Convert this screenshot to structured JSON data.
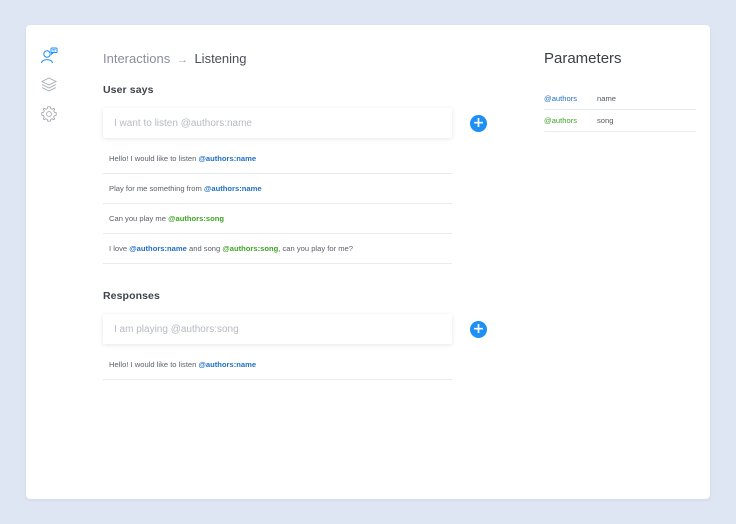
{
  "sidebar": {
    "icons": [
      {
        "name": "user-chat-icon",
        "active": true
      },
      {
        "name": "layers-icon",
        "active": false
      },
      {
        "name": "gear-icon",
        "active": false
      }
    ]
  },
  "breadcrumb": {
    "parent": "Interactions",
    "separator": "→",
    "current": "Listening"
  },
  "user_says": {
    "title": "User says",
    "placeholder": "I want to listen @authors:name",
    "add_label": "+",
    "items": [
      [
        {
          "text": "Hello! I would like to listen "
        },
        {
          "text": "@authors:name",
          "entity": "blue"
        }
      ],
      [
        {
          "text": "Play for me something from "
        },
        {
          "text": "@authors:name",
          "entity": "blue"
        }
      ],
      [
        {
          "text": "Can you play me "
        },
        {
          "text": "@authors:song",
          "entity": "green"
        }
      ],
      [
        {
          "text": "I love "
        },
        {
          "text": "@authors:name",
          "entity": "blue"
        },
        {
          "text": " and song "
        },
        {
          "text": "@authors:song",
          "entity": "green"
        },
        {
          "text": ", can you play for me?"
        }
      ]
    ]
  },
  "responses": {
    "title": "Responses",
    "placeholder": "I am playing @authors:song",
    "add_label": "+",
    "items": [
      [
        {
          "text": "Hello! I would like to listen "
        },
        {
          "text": "@authors:name",
          "entity": "blue"
        }
      ]
    ]
  },
  "parameters": {
    "title": "Parameters",
    "rows": [
      {
        "entity": "@authors",
        "name": "name",
        "color": "blue"
      },
      {
        "entity": "@authors",
        "name": "song",
        "color": "green"
      }
    ]
  },
  "colors": {
    "accent": "#1d8ff5",
    "entity_blue": "#1f6fc6",
    "entity_green": "#3ea424",
    "background": "#dfe6f3"
  }
}
